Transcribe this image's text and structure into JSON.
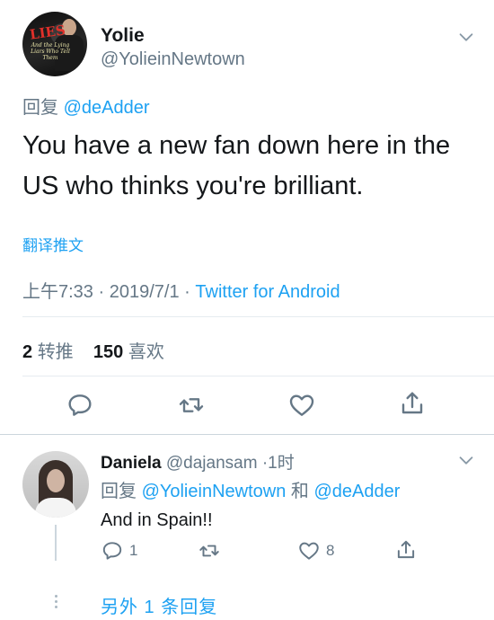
{
  "tweet": {
    "author_name": "Yolie",
    "author_handle": "@YolieinNewtown",
    "avatar_text_main": "LIES",
    "avatar_text_sub": "And the Lying Liars Who Tell Them",
    "reply_prefix": "回复",
    "reply_to": "@deAdder",
    "text": "You have a new fan down here in the US who thinks you're brilliant.",
    "translate_label": "翻译推文",
    "time": "上午7:33",
    "date": "2019/7/1",
    "separator": "·",
    "source": "Twitter for Android",
    "retweet_count": "2",
    "retweet_label": "转推",
    "like_count": "150",
    "like_label": "喜欢"
  },
  "reply": {
    "author_name": "Daniela",
    "author_handle": "@dajansam",
    "time": "1时",
    "reply_prefix": "回复",
    "reply_to_1": "@YolieinNewtown",
    "and_word": "和",
    "reply_to_2": "@deAdder",
    "text": "And in Spain!!",
    "reply_count": "1",
    "like_count": "8"
  },
  "more_replies": "另外 1 条回复",
  "colors": {
    "link": "#1da1f2",
    "secondary": "#657786",
    "icon": "#657786",
    "divider": "#e6ecf0"
  },
  "icons": [
    "reply-icon",
    "retweet-icon",
    "like-icon",
    "share-icon",
    "chevron-down-icon"
  ]
}
